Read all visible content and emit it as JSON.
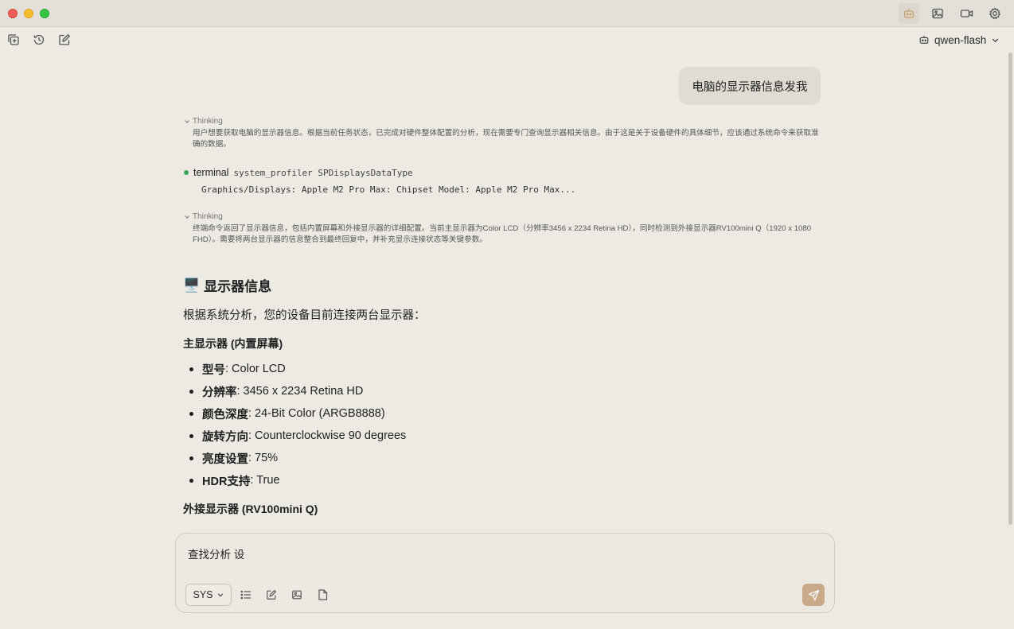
{
  "model": {
    "name": "qwen-flash"
  },
  "user_message": "电脑的显示器信息发我",
  "thinking1": {
    "label": "Thinking",
    "text": "用户想要获取电脑的显示器信息。根据当前任务状态，已完成对硬件整体配置的分析，现在需要专门查询显示器相关信息。由于这是关于设备硬件的具体细节，应该通过系统命令来获取准确的数据。"
  },
  "terminal": {
    "name": "terminal",
    "command": "system_profiler SPDisplaysDataType",
    "output": "Graphics/Displays: Apple M2 Pro Max: Chipset Model: Apple M2 Pro Max..."
  },
  "thinking2": {
    "label": "Thinking",
    "text": "终端命令返回了显示器信息，包括内置屏幕和外接显示器的详细配置。当前主显示器为Color LCD（分辨率3456 x 2234 Retina HD），同时检测到外接显示器RV100mini Q（1920 x 1080 FHD）。需要将两台显示器的信息整合到最终回复中，并补充显示连接状态等关键参数。"
  },
  "answer": {
    "heading_emoji": "🖥️",
    "heading": "显示器信息",
    "intro": "根据系统分析，您的设备目前连接两台显示器：",
    "primary_title": "主显示器 (内置屏幕)",
    "primary_items": [
      {
        "k": "型号",
        "v": ": Color LCD"
      },
      {
        "k": "分辨率",
        "v": ": 3456 x 2234 Retina HD"
      },
      {
        "k": "颜色深度",
        "v": ": 24-Bit Color (ARGB8888)"
      },
      {
        "k": "旋转方向",
        "v": ": Counterclockwise 90 degrees"
      },
      {
        "k": "亮度设置",
        "v": ": 75%"
      },
      {
        "k": "HDR支持",
        "v": ": True"
      }
    ],
    "external_title": "外接显示器 (RV100mini Q)"
  },
  "input": {
    "value": "查找分析 设"
  },
  "sys_select": {
    "label": "SYS"
  },
  "colors": {
    "accent": "#c9a987",
    "background": "#edeae4",
    "status_dot": "#3aa757"
  }
}
